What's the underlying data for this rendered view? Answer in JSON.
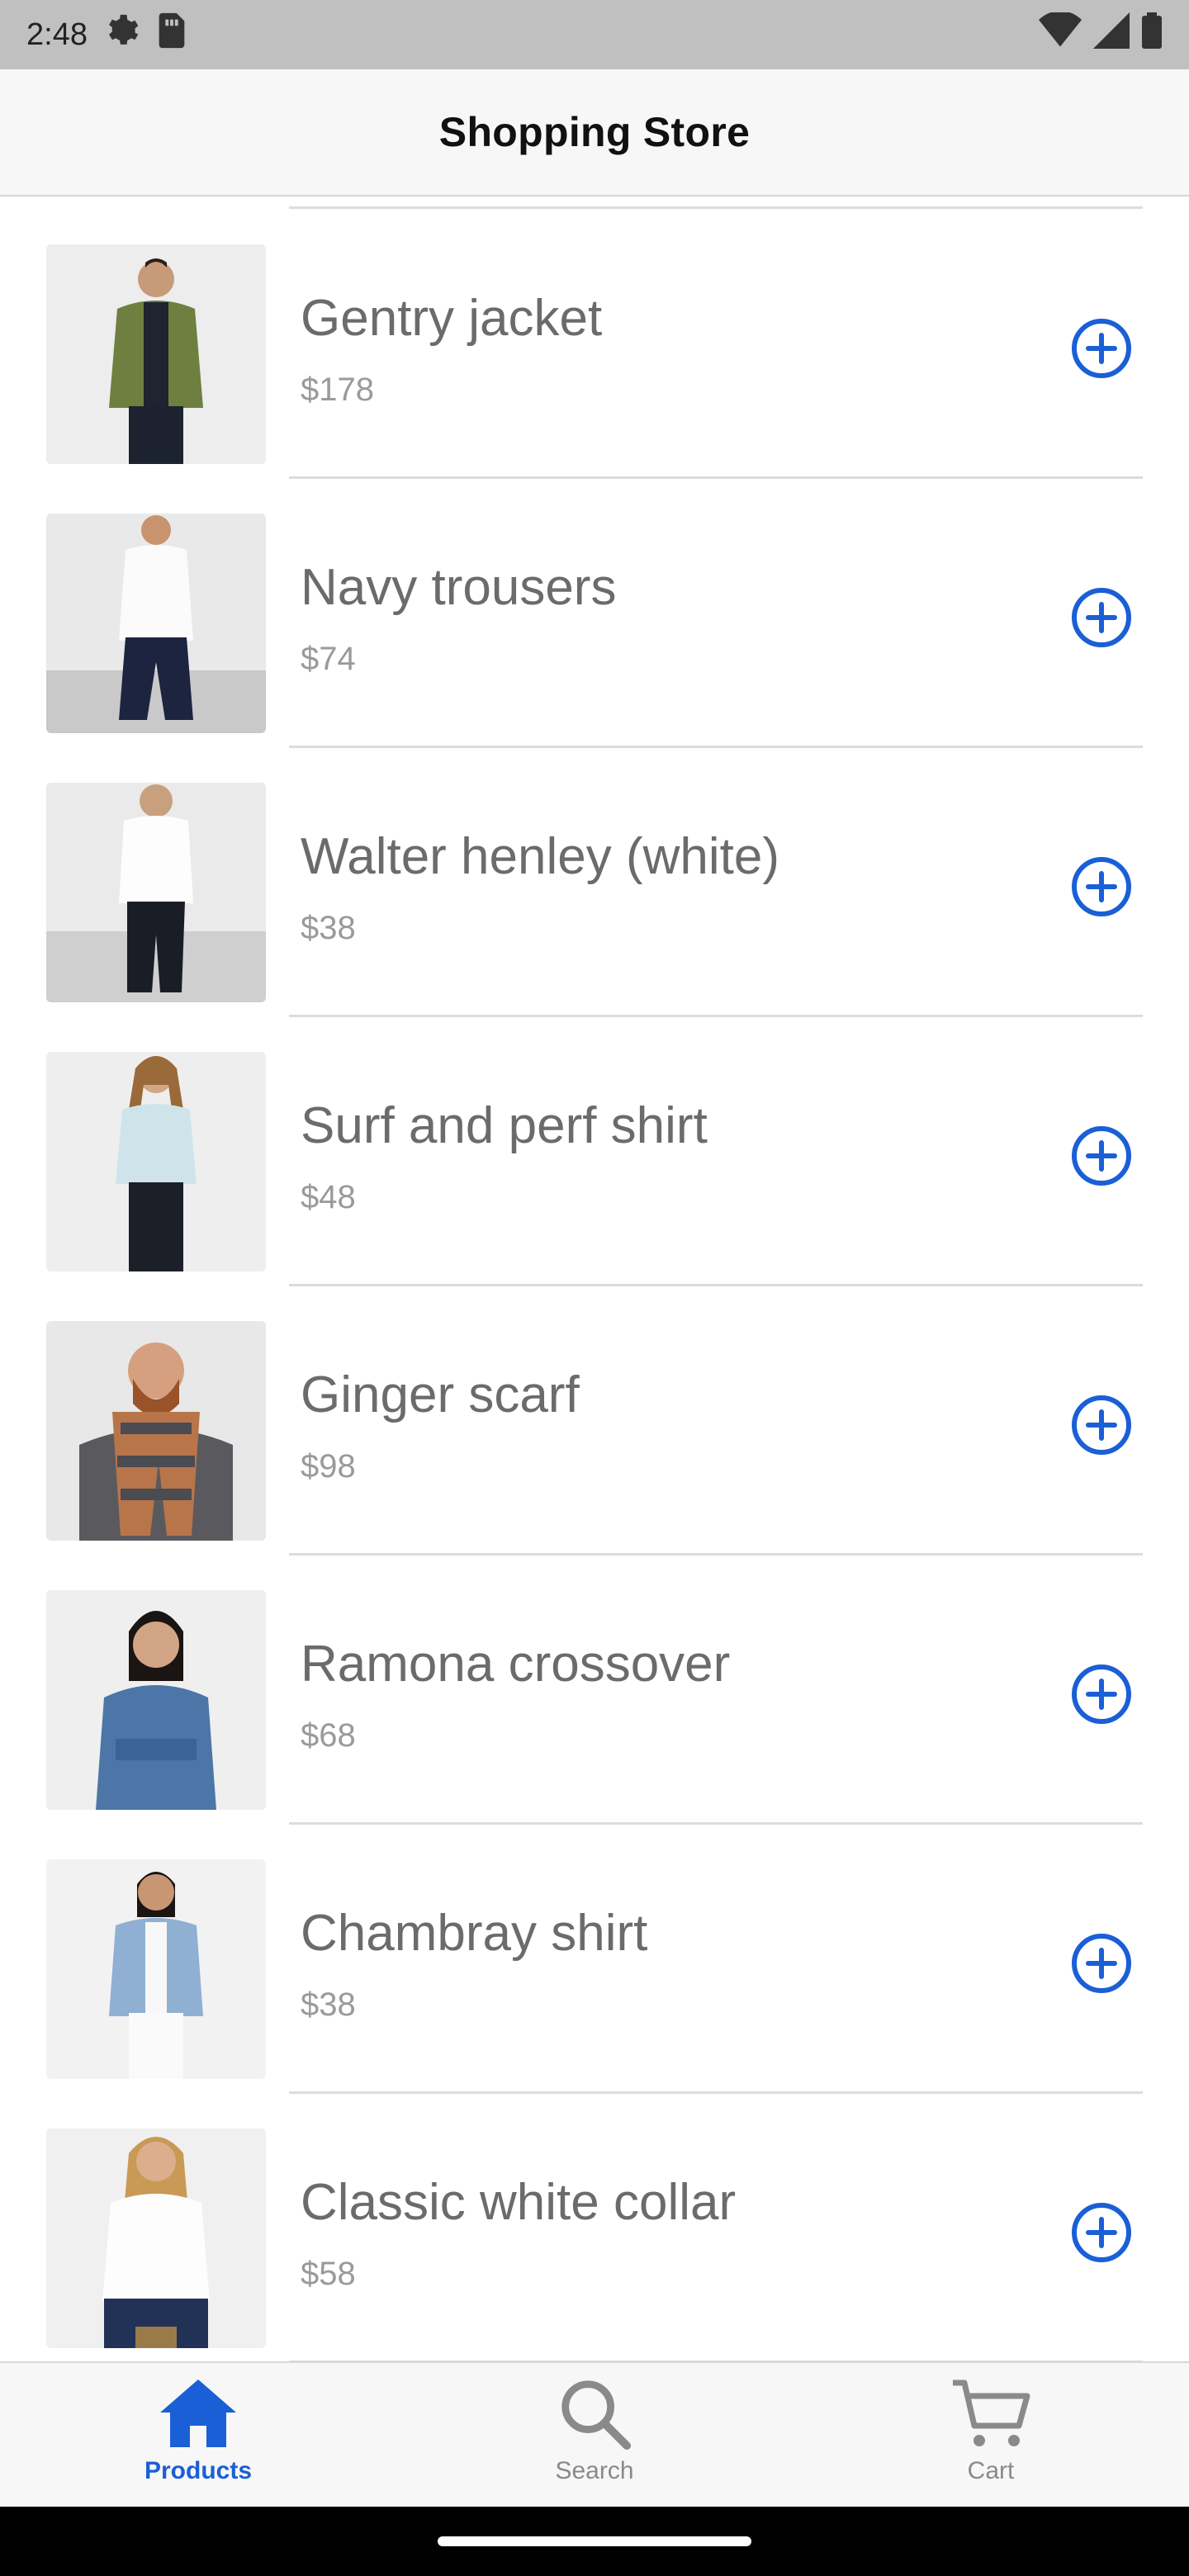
{
  "status_bar": {
    "time": "2:48",
    "left_icons": [
      "settings-gear-icon",
      "sim-card-icon"
    ],
    "right_icons": [
      "wifi-icon",
      "cellular-signal-icon",
      "battery-icon"
    ]
  },
  "header": {
    "title": "Shopping Store"
  },
  "products": [
    {
      "name": "Gentry jacket",
      "price": "$178",
      "add_icon": "plus-circle-icon"
    },
    {
      "name": "Navy trousers",
      "price": "$74",
      "add_icon": "plus-circle-icon"
    },
    {
      "name": "Walter henley (white)",
      "price": "$38",
      "add_icon": "plus-circle-icon"
    },
    {
      "name": "Surf and perf shirt",
      "price": "$48",
      "add_icon": "plus-circle-icon"
    },
    {
      "name": "Ginger scarf",
      "price": "$98",
      "add_icon": "plus-circle-icon"
    },
    {
      "name": "Ramona crossover",
      "price": "$68",
      "add_icon": "plus-circle-icon"
    },
    {
      "name": "Chambray shirt",
      "price": "$38",
      "add_icon": "plus-circle-icon"
    },
    {
      "name": "Classic white collar",
      "price": "$58",
      "add_icon": "plus-circle-icon"
    }
  ],
  "tabs": [
    {
      "label": "Products",
      "icon": "home-icon",
      "active": true
    },
    {
      "label": "Search",
      "icon": "search-icon",
      "active": false
    },
    {
      "label": "Cart",
      "icon": "cart-icon",
      "active": false
    }
  ],
  "colors": {
    "accent": "#1a5fd6",
    "status_bar": "#c0c0c0",
    "header_bg": "#f7f7f7",
    "inactive_tab": "#8a8a8a"
  }
}
